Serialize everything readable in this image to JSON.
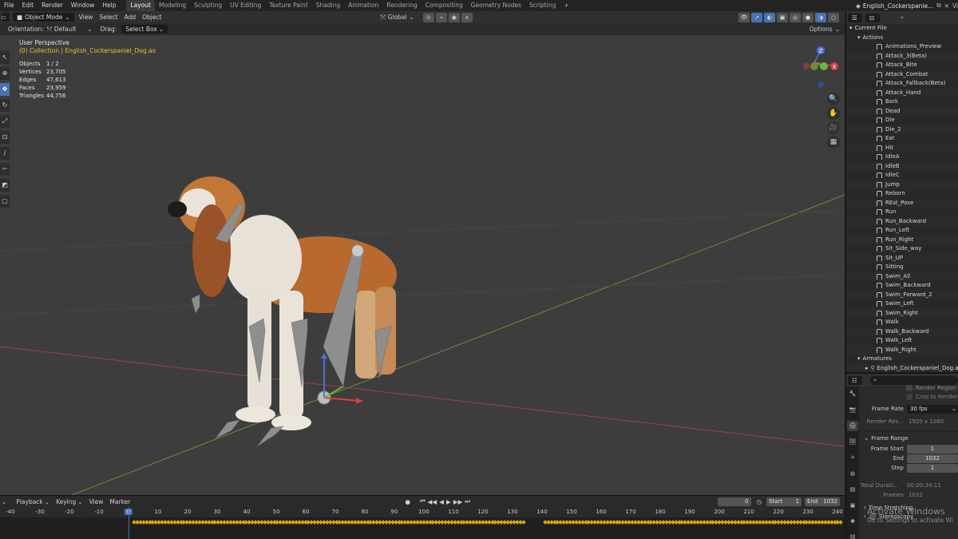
{
  "menus": [
    "File",
    "Edit",
    "Render",
    "Window",
    "Help"
  ],
  "workspace_tabs": [
    "Layout",
    "Modeling",
    "Sculpting",
    "UV Editing",
    "Texture Paint",
    "Shading",
    "Animation",
    "Rendering",
    "Compositing",
    "Geometry Nodes",
    "Scripting"
  ],
  "active_tab": "Layout",
  "add_tab_label": "+",
  "scene_name": "English_Cockerspanie...",
  "viewport": {
    "mode": "Object Mode",
    "menus": [
      "View",
      "Select",
      "Add",
      "Object"
    ],
    "transform_orientation": "Global",
    "orientation_label": "Orientation:",
    "orientation_value": "Default",
    "drag_label": "Drag:",
    "drag_value": "Select Box",
    "options": "Options",
    "perspective": "User Perspective",
    "collection": "(0) Collection | English_Cockerspaniel_Dog.ao",
    "stats": [
      {
        "label": "Objects",
        "value": "1 / 2"
      },
      {
        "label": "Vertices",
        "value": "23,705"
      },
      {
        "label": "Edges",
        "value": "47,613"
      },
      {
        "label": "Faces",
        "value": "23,959"
      },
      {
        "label": "Triangles",
        "value": "44,756"
      }
    ],
    "gizmo": {
      "z": "Z",
      "x": "X"
    }
  },
  "outliner": {
    "root": "Current File",
    "actions_label": "Actions",
    "actions": [
      "Animations_Preview",
      "Attack_3(Beta)",
      "Attack_Bite",
      "Attack_Combat",
      "Attack_Fallback(Beta)",
      "Attack_Hand",
      "Bark",
      "Dead",
      "Die",
      "Die_2",
      "Eat",
      "Hit",
      "IdleA",
      "IdleB",
      "IdleC",
      "Jump",
      "Reborn",
      "REst_Pose",
      "Run",
      "Run_Backward",
      "Run_Left",
      "Run_Right",
      "Sit_Side_way",
      "Sit_UP",
      "Sitting",
      "Swim_All",
      "Swim_Backward",
      "Swim_Forward_2",
      "Swim_Left",
      "Swim_Right",
      "Walk",
      "Walk_Backward",
      "Walk_Left",
      "Walk_Right"
    ],
    "armatures_label": "Armatures",
    "armature_item": "English_Cockerspaniel_Dog.ao"
  },
  "properties": {
    "render_region": "Render Region",
    "crop_to_render": "Crop to Render",
    "frame_rate_label": "Frame Rate",
    "frame_rate_value": "30 fps",
    "render_res_label": "Render Res...",
    "render_res_value": "1920 x 1080",
    "frame_range_label": "Frame Range",
    "frame_start_label": "Frame Start",
    "frame_start_value": "1",
    "end_label": "End",
    "end_value": "1032",
    "step_label": "Step",
    "step_value": "1",
    "total_duration_label": "Total Durati...",
    "total_duration_value": "00:00:34:11",
    "frames_label": "Frames",
    "frames_value": "1032",
    "time_stretching": "Time Stretching",
    "stereoscopy": "Stereoscopy"
  },
  "timeline": {
    "menus": [
      "Playback",
      "Keying",
      "View",
      "Marker"
    ],
    "current_frame": "0",
    "start_label": "Start",
    "start_value": "1",
    "end_label": "End",
    "end_value": "1032",
    "ruler": [
      "-40",
      "-30",
      "-20",
      "-10",
      "0",
      "10",
      "20",
      "30",
      "40",
      "50",
      "60",
      "70",
      "80",
      "90",
      "100",
      "110",
      "120",
      "130",
      "140",
      "150",
      "160",
      "170",
      "180",
      "190",
      "200",
      "210",
      "220",
      "230",
      "240"
    ]
  },
  "watermark": {
    "title": "Activate Windows",
    "subtitle": "Go to Settings to activate Wi"
  },
  "colors": {
    "accent": "#4772b3",
    "keyframe": "#d9a800",
    "collection_text": "#e8c23a"
  }
}
